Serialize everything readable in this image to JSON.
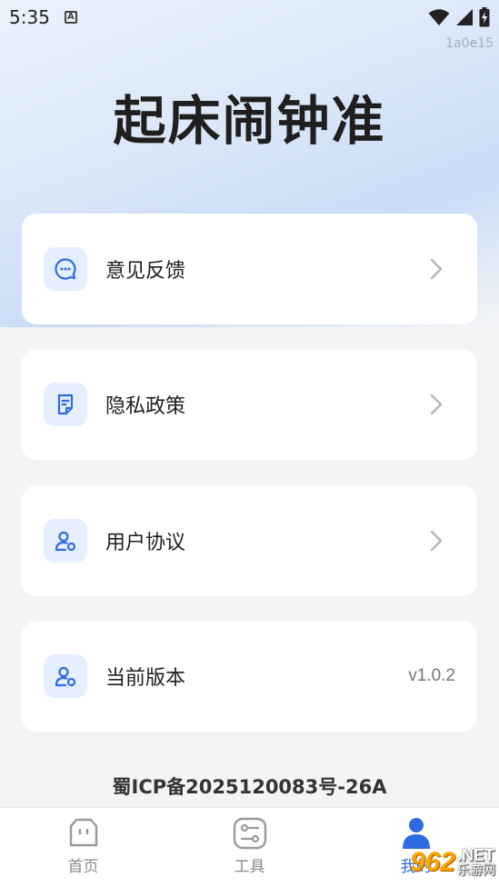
{
  "status_bar": {
    "time": "5:35",
    "notification_badge": "A",
    "icons": [
      "wifi-icon",
      "signal-icon",
      "battery-charging-icon"
    ]
  },
  "build_id": "1a0e15",
  "app_title": "起床闹钟准",
  "menu": [
    {
      "label": "意见反馈",
      "icon": "feedback-chat-icon"
    },
    {
      "label": "隐私政策",
      "icon": "privacy-document-icon"
    },
    {
      "label": "用户协议",
      "icon": "user-agreement-icon"
    },
    {
      "label": "当前版本",
      "icon": "user-version-icon",
      "value": "v1.0.2"
    }
  ],
  "icp": "蜀ICP备2025120083号-26A",
  "bottom_nav": [
    {
      "label": "首页",
      "icon": "home-face-icon",
      "active": false
    },
    {
      "label": "工具",
      "icon": "tools-toggle-icon",
      "active": false
    },
    {
      "label": "我的",
      "icon": "profile-icon",
      "active": true
    }
  ],
  "watermark": {
    "logo": "962",
    "net": ".NET",
    "text": "乐游网"
  },
  "colors": {
    "accent": "#2f6be0",
    "icon_bg": "#e5efff",
    "card_bg": "#ffffff",
    "page_bg": "#f3f4f6"
  }
}
